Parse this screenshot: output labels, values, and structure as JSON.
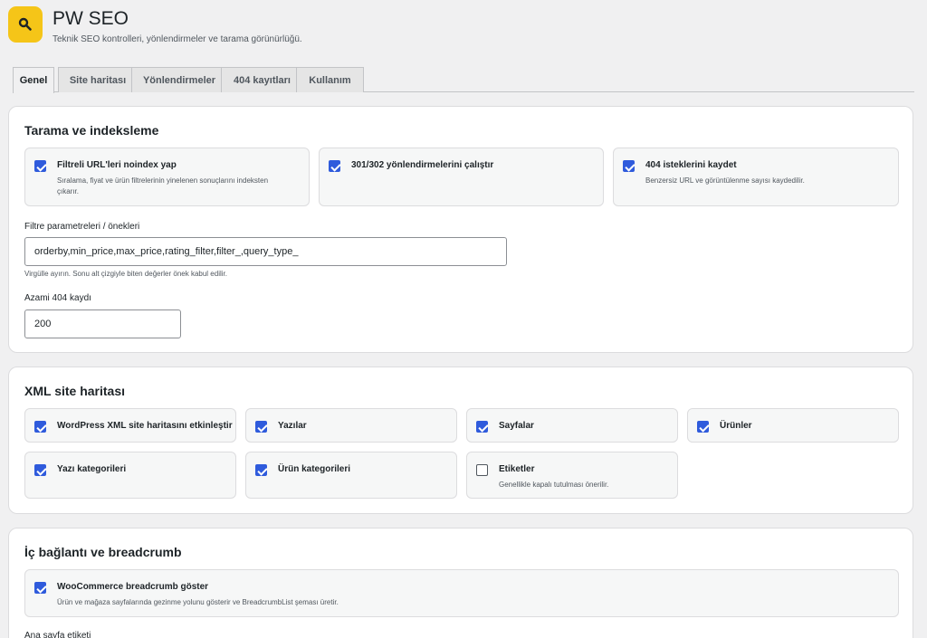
{
  "app": {
    "title": "PW SEO",
    "subtitle": "Teknik SEO kontrolleri, yönlendirmeler ve tarama görünürlüğü.",
    "logo_icon": "search-icon",
    "accent": "#f5c518"
  },
  "tabs": [
    {
      "label": "Genel",
      "active": true
    },
    {
      "label": "Site haritası",
      "active": false
    },
    {
      "label": "Yönlendirmeler",
      "active": false
    },
    {
      "label": "404 kayıtları",
      "active": false
    },
    {
      "label": "Kullanım",
      "active": false
    }
  ],
  "crawl": {
    "title": "Tarama ve indeksleme",
    "options": [
      {
        "label": "Filtreli URL'leri noindex yap",
        "desc": "Sıralama, fiyat ve ürün filtrelerinin yinelenen sonuçlarını indeksten çıkarır.",
        "checked": true
      },
      {
        "label": "301/302 yönlendirmelerini çalıştır",
        "desc": "",
        "checked": true
      },
      {
        "label": "404 isteklerini kaydet",
        "desc": "Benzersiz URL ve görüntülenme sayısı kaydedilir.",
        "checked": true
      }
    ],
    "filter_label": "Filtre parametreleri / önekleri",
    "filter_value": "orderby,min_price,max_price,rating_filter,filter_,query_type_",
    "filter_help": "Virgülle ayırın. Sonu alt çizgiyle biten değerler önek kabul edilir.",
    "max404_label": "Azami 404 kaydı",
    "max404_value": "200"
  },
  "sitemap": {
    "title": "XML site haritası",
    "options": [
      {
        "label": "WordPress XML site haritasını etkinleştir",
        "desc": "",
        "checked": true
      },
      {
        "label": "Yazılar",
        "desc": "",
        "checked": true
      },
      {
        "label": "Sayfalar",
        "desc": "",
        "checked": true
      },
      {
        "label": "Ürünler",
        "desc": "",
        "checked": true
      },
      {
        "label": "Yazı kategorileri",
        "desc": "",
        "checked": true
      },
      {
        "label": "Ürün kategorileri",
        "desc": "",
        "checked": true
      },
      {
        "label": "Etiketler",
        "desc": "Genellikle kapalı tutulması önerilir.",
        "checked": false
      }
    ]
  },
  "breadcrumb": {
    "title": "İç bağlantı ve breadcrumb",
    "option": {
      "label": "WooCommerce breadcrumb göster",
      "desc": "Ürün ve mağaza sayfalarında gezinme yolunu gösterir ve BreadcrumbList şeması üretir.",
      "checked": true
    },
    "home_label": "Ana sayfa etiketi"
  }
}
